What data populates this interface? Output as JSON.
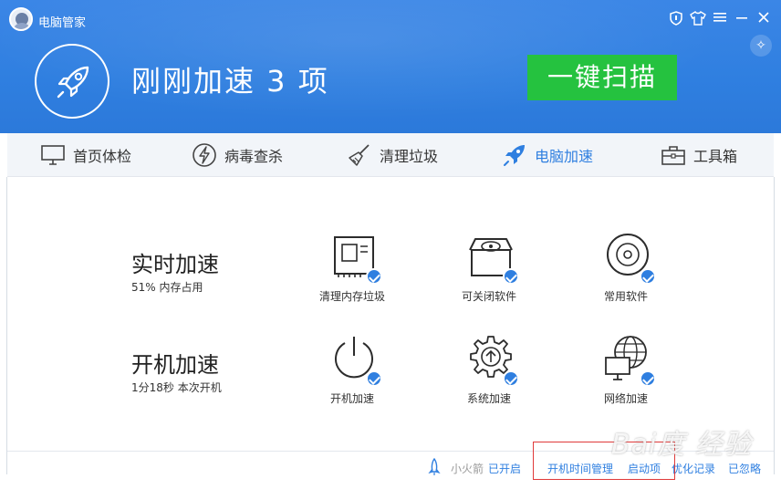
{
  "app": {
    "title": "电脑管家",
    "headline": "刚刚加速 3 项",
    "scan_button": "一键扫描"
  },
  "nav": {
    "items": [
      {
        "label": "首页体检",
        "icon": "monitor-icon"
      },
      {
        "label": "病毒查杀",
        "icon": "lightning-shield-icon"
      },
      {
        "label": "清理垃圾",
        "icon": "broom-icon"
      },
      {
        "label": "电脑加速",
        "icon": "rocket-icon"
      },
      {
        "label": "工具箱",
        "icon": "toolbox-icon"
      }
    ],
    "active_index": 3
  },
  "realtime": {
    "title": "实时加速",
    "subtitle": "51% 内存占用",
    "features": [
      {
        "label": "清理内存垃圾",
        "icon": "memory-chip-icon"
      },
      {
        "label": "可关闭软件",
        "icon": "disk-box-icon"
      },
      {
        "label": "常用软件",
        "icon": "cd-icon"
      }
    ]
  },
  "boot": {
    "title": "开机加速",
    "subtitle": "1分18秒 本次开机",
    "features": [
      {
        "label": "开机加速",
        "icon": "power-icon"
      },
      {
        "label": "系统加速",
        "icon": "gear-icon"
      },
      {
        "label": "网络加速",
        "icon": "globe-monitor-icon"
      }
    ]
  },
  "footer": {
    "rocket_label": "小火箭",
    "rocket_status": "已开启",
    "boot_time_mgmt": "开机时间管理",
    "startup_items": "启动项",
    "optimize_log": "优化记录",
    "ignored": "已忽略"
  },
  "watermark": "Bai度 经验",
  "colors": {
    "accent": "#2f7fe0",
    "scan_button": "#25c23f",
    "highlight_box": "#e03a3a"
  }
}
